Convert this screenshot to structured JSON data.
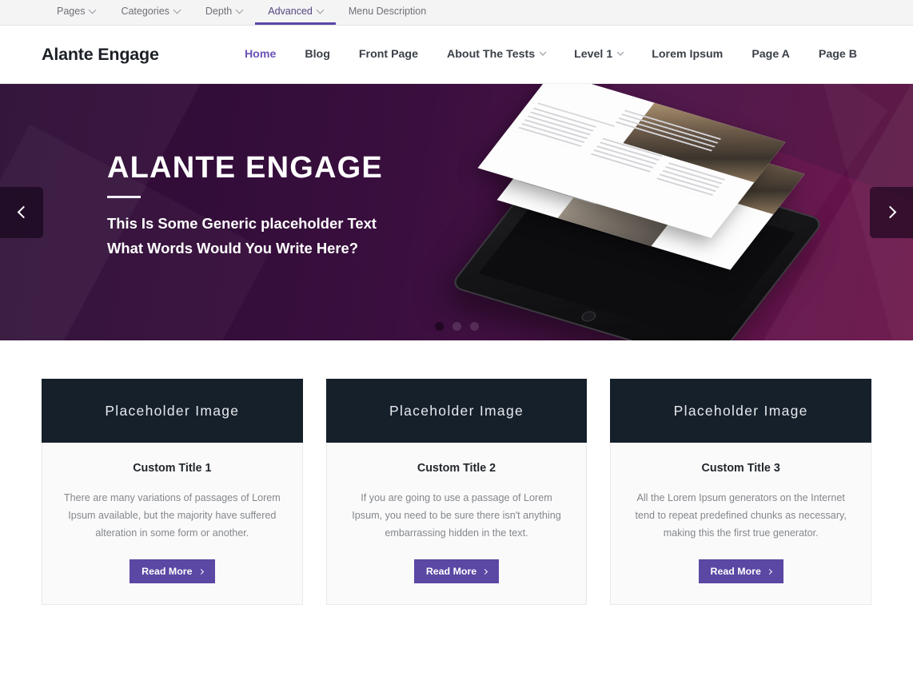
{
  "admin_bar": {
    "tabs": [
      {
        "label": "Pages",
        "has_caret": true,
        "active": false
      },
      {
        "label": "Categories",
        "has_caret": true,
        "active": false
      },
      {
        "label": "Depth",
        "has_caret": true,
        "active": false
      },
      {
        "label": "Advanced",
        "has_caret": true,
        "active": true
      },
      {
        "label": "Menu Description",
        "has_caret": false,
        "active": false
      }
    ]
  },
  "header": {
    "brand": "Alante Engage",
    "nav": [
      {
        "label": "Home",
        "has_caret": false,
        "active": true
      },
      {
        "label": "Blog",
        "has_caret": false,
        "active": false
      },
      {
        "label": "Front Page",
        "has_caret": false,
        "active": false
      },
      {
        "label": "About The Tests",
        "has_caret": true,
        "active": false
      },
      {
        "label": "Level 1",
        "has_caret": true,
        "active": false
      },
      {
        "label": "Lorem Ipsum",
        "has_caret": false,
        "active": false
      },
      {
        "label": "Page A",
        "has_caret": false,
        "active": false
      },
      {
        "label": "Page B",
        "has_caret": false,
        "active": false
      }
    ]
  },
  "hero": {
    "title": "ALANTE ENGAGE",
    "subtitle_line1": "This Is Some Generic placeholder Text",
    "subtitle_line2": "What Words Would You Write Here?",
    "prev_icon": "chevron-left-icon",
    "next_icon": "chevron-right-icon",
    "slides": 3,
    "active_slide": 1,
    "accent_color": "#3a0f3f",
    "visual": "tablet-with-layered-webpage-mockup"
  },
  "cards": [
    {
      "media_label": "Placeholder Image",
      "title": "Custom Title 1",
      "text": "There are many variations of passages of Lorem Ipsum available, but the majority have suffered alteration in some form or another.",
      "button_label": "Read More"
    },
    {
      "media_label": "Placeholder Image",
      "title": "Custom Title 2",
      "text": "If you are going to use a passage of Lorem Ipsum, you need to be sure there isn't anything embarrassing hidden in the text.",
      "button_label": "Read More"
    },
    {
      "media_label": "Placeholder Image",
      "title": "Custom Title 3",
      "text": "All the Lorem Ipsum generators on the Internet tend to repeat predefined chunks as necessary, making this the first true generator.",
      "button_label": "Read More"
    }
  ],
  "colors": {
    "brand_purple": "#5b47a4",
    "active_nav": "#6b52b5",
    "hero_dark": "#2b0b33",
    "card_media": "#16202b"
  }
}
